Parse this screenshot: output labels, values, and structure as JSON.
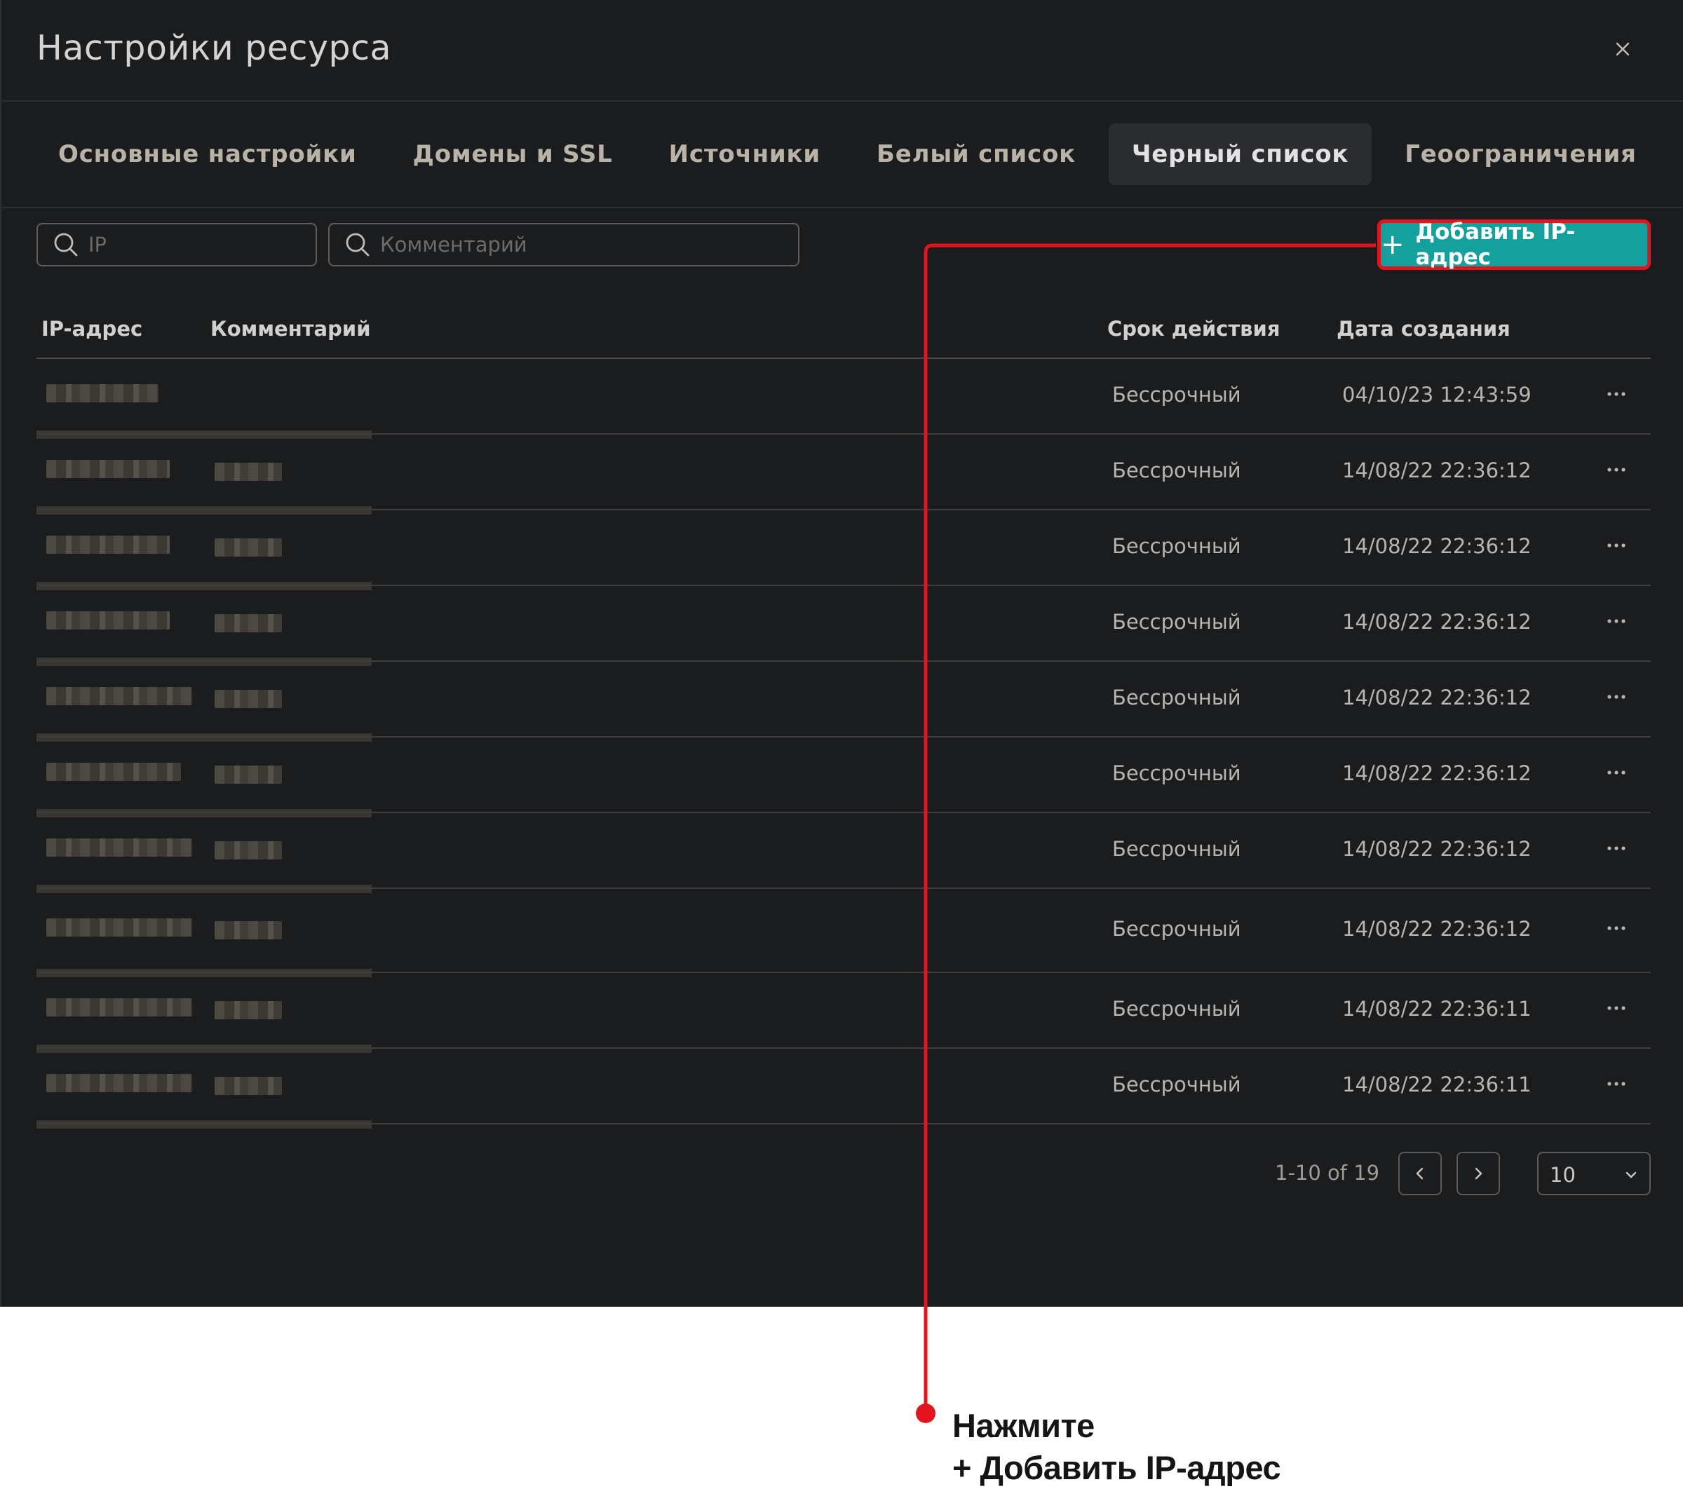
{
  "modal": {
    "title": "Настройки ресурса",
    "close_icon": "close-icon"
  },
  "tabs": [
    {
      "label": "Основные настройки",
      "active": false
    },
    {
      "label": "Домены и SSL",
      "active": false
    },
    {
      "label": "Источники",
      "active": false
    },
    {
      "label": "Белый список",
      "active": false
    },
    {
      "label": "Черный список",
      "active": true
    },
    {
      "label": "Геоограничения",
      "active": false
    }
  ],
  "filters": {
    "ip_placeholder": "IP",
    "comment_placeholder": "Комментарий",
    "search_icon": "search-icon"
  },
  "add_button": {
    "label": "Добавить IP-адрес",
    "icon": "plus-icon",
    "accent_color": "#14a19d",
    "highlight_color": "#e4141e"
  },
  "table": {
    "headers": {
      "ip": "IP-адрес",
      "comment": "Комментарий",
      "expiry": "Срок действия",
      "created": "Дата создания"
    },
    "rows": [
      {
        "ip": "[blurred]",
        "comment": "",
        "expiry": "Бессрочный",
        "created": "04/10/23 12:43:59"
      },
      {
        "ip": "[blurred]",
        "comment": "[blurred]",
        "expiry": "Бессрочный",
        "created": "14/08/22 22:36:12"
      },
      {
        "ip": "[blurred]",
        "comment": "[blurred]",
        "expiry": "Бессрочный",
        "created": "14/08/22 22:36:12"
      },
      {
        "ip": "[blurred]",
        "comment": "[blurred]",
        "expiry": "Бессрочный",
        "created": "14/08/22 22:36:12"
      },
      {
        "ip": "[blurred]",
        "comment": "[blurred]",
        "expiry": "Бессрочный",
        "created": "14/08/22 22:36:12"
      },
      {
        "ip": "[blurred]",
        "comment": "[blurred]",
        "expiry": "Бессрочный",
        "created": "14/08/22 22:36:12"
      },
      {
        "ip": "[blurred]",
        "comment": "[blurred]",
        "expiry": "Бессрочный",
        "created": "14/08/22 22:36:12"
      },
      {
        "ip": "[blurred]",
        "comment": "[blurred]",
        "expiry": "Бессрочный",
        "created": "14/08/22 22:36:12"
      },
      {
        "ip": "[blurred]",
        "comment": "[blurred]",
        "expiry": "Бессрочный",
        "created": "14/08/22 22:36:11"
      },
      {
        "ip": "[blurred]",
        "comment": "[blurred]",
        "expiry": "Бессрочный",
        "created": "14/08/22 22:36:11"
      }
    ],
    "row_menu_icon": "more-horizontal-icon"
  },
  "pagination": {
    "info": "1-10 of 19",
    "prev_icon": "chevron-left-icon",
    "next_icon": "chevron-right-icon",
    "page_size": "10",
    "page_size_icon": "chevron-down-icon"
  },
  "callout": {
    "line1": "Нажмите",
    "line2": "+ Добавить IP-адрес",
    "color": "#e4141e"
  }
}
